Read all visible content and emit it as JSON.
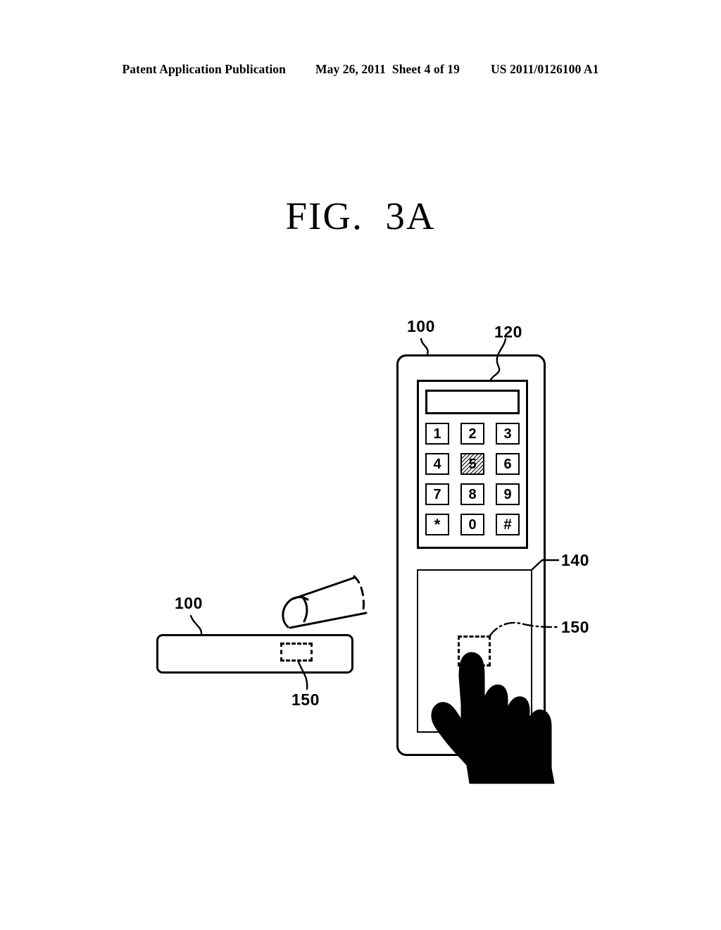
{
  "header": {
    "publication": "Patent Application Publication",
    "date": "May 26, 2011",
    "sheet": "Sheet 4 of 19",
    "doc_number": "US 2011/0126100 A1"
  },
  "figure": {
    "title": "FIG.  3A"
  },
  "side_view": {
    "device_label": "100",
    "region_label": "150"
  },
  "front_view": {
    "device_label": "100",
    "keypad_label": "120",
    "touchpad_label": "140",
    "region_label": "150",
    "display_value": "",
    "keypad_keys": [
      {
        "label": "1",
        "pressed": false
      },
      {
        "label": "2",
        "pressed": false
      },
      {
        "label": "3",
        "pressed": false
      },
      {
        "label": "4",
        "pressed": false
      },
      {
        "label": "5",
        "pressed": true
      },
      {
        "label": "6",
        "pressed": false
      },
      {
        "label": "7",
        "pressed": false
      },
      {
        "label": "8",
        "pressed": false
      },
      {
        "label": "9",
        "pressed": false
      },
      {
        "label": "*",
        "pressed": false
      },
      {
        "label": "0",
        "pressed": false
      },
      {
        "label": "#",
        "pressed": false
      }
    ]
  },
  "colors": {
    "ink": "#000000",
    "paper": "#ffffff"
  }
}
